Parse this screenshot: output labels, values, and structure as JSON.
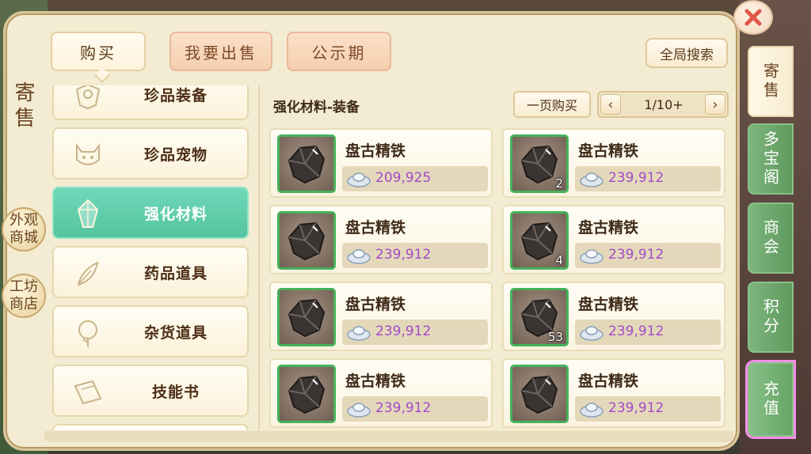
{
  "window": {
    "title": "寄售"
  },
  "side_buttons": [
    "外观商城",
    "工坊商店"
  ],
  "top_tabs": [
    {
      "label": "购买"
    },
    {
      "label": "我要出售"
    },
    {
      "label": "公示期"
    }
  ],
  "global_search_label": "全局搜索",
  "categories": [
    {
      "label": "珍品装备",
      "icon": "armor-icon"
    },
    {
      "label": "珍品宠物",
      "icon": "cat-icon"
    },
    {
      "label": "强化材料",
      "icon": "crystal-icon"
    },
    {
      "label": "药品道具",
      "icon": "herb-icon"
    },
    {
      "label": "杂货道具",
      "icon": "flower-icon"
    },
    {
      "label": "技能书",
      "icon": "book-icon"
    }
  ],
  "selected_category": "强化材料",
  "section_title": "强化材料-装备",
  "buy_page_label": "一页购买",
  "pager": {
    "text": "1/10+",
    "prev": "‹",
    "next": "›"
  },
  "items": [
    {
      "name": "盘古精铁",
      "price": "209,925",
      "qty": ""
    },
    {
      "name": "盘古精铁",
      "price": "239,912",
      "qty": "2"
    },
    {
      "name": "盘古精铁",
      "price": "239,912",
      "qty": ""
    },
    {
      "name": "盘古精铁",
      "price": "239,912",
      "qty": "4"
    },
    {
      "name": "盘古精铁",
      "price": "239,912",
      "qty": ""
    },
    {
      "name": "盘古精铁",
      "price": "239,912",
      "qty": "53"
    },
    {
      "name": "盘古精铁",
      "price": "239,912",
      "qty": ""
    },
    {
      "name": "盘古精铁",
      "price": "239,912",
      "qty": ""
    }
  ],
  "right_tabs": [
    {
      "label": "寄售"
    },
    {
      "label": "多宝阁"
    },
    {
      "label": "商会"
    },
    {
      "label": "积分"
    },
    {
      "label": "充值"
    }
  ],
  "colors": {
    "accent_green": "#55c4a0",
    "price_purple": "#a24ac8",
    "thumb_border": "#45b25a",
    "highlight_pink": "#f48ee9"
  }
}
